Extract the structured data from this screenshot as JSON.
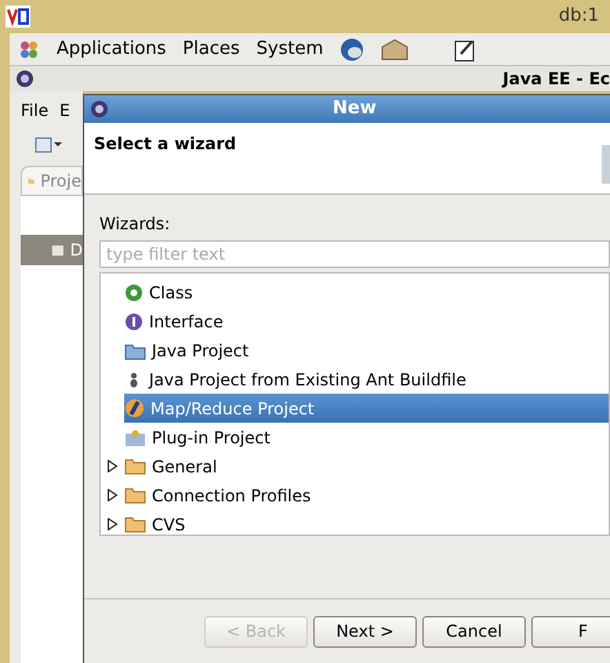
{
  "vnc_window": {
    "title": "db:1"
  },
  "panel": {
    "menus": [
      "Applications",
      "Places",
      "System"
    ]
  },
  "eclipse": {
    "title": "Java EE - Ec",
    "menus": [
      "File",
      "E"
    ],
    "view_tab": "Proje",
    "view_item": "D"
  },
  "dialog": {
    "title": "New",
    "heading": "Select a wizard",
    "wizards_label": "Wizards:",
    "filter": {
      "placeholder": "type filter text"
    },
    "tree": [
      {
        "kind": "class",
        "label": "Class",
        "selected": false
      },
      {
        "kind": "interface",
        "label": "Interface",
        "selected": false
      },
      {
        "kind": "project",
        "label": "Java Project",
        "selected": false
      },
      {
        "kind": "ant",
        "label": "Java Project from Existing Ant Buildfile",
        "selected": false
      },
      {
        "kind": "mapreduce",
        "label": "Map/Reduce Project",
        "selected": true
      },
      {
        "kind": "plugin",
        "label": "Plug-in Project",
        "selected": false
      },
      {
        "kind": "folder",
        "label": "General",
        "expanded": false,
        "selected": false
      },
      {
        "kind": "folder",
        "label": "Connection Profiles",
        "expanded": false,
        "selected": false
      },
      {
        "kind": "folder",
        "label": "CVS",
        "expanded": false,
        "selected": false
      }
    ],
    "buttons": [
      {
        "label": "< Back",
        "disabled": true
      },
      {
        "label": "Next >",
        "disabled": false
      },
      {
        "label": "Cancel",
        "disabled": false
      },
      {
        "label": "F",
        "disabled": false
      }
    ]
  }
}
